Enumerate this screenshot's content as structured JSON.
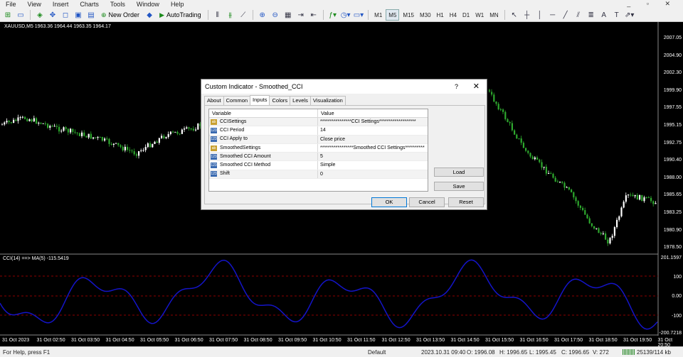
{
  "menu": [
    "File",
    "View",
    "Insert",
    "Charts",
    "Tools",
    "Window",
    "Help"
  ],
  "toolbar": {
    "new_order": "New Order",
    "autotrading": "AutoTrading",
    "timeframes": [
      "M1",
      "M5",
      "M15",
      "M30",
      "H1",
      "H4",
      "D1",
      "W1",
      "MN"
    ],
    "active_timeframe": "M5"
  },
  "chart": {
    "title": "XAUUSD,M5  1963.36 1964.44 1963.35 1964.17",
    "price_labels": [
      "2007.05",
      "2004.90",
      "2002.30",
      "1999.90",
      "1997.55",
      "1995.15",
      "1992.75",
      "1990.40",
      "1988.00",
      "1985.65",
      "1983.25",
      "1980.90",
      "1978.50"
    ],
    "indicator_title": "CCI(14) ==> MA(5) -115.5419",
    "indicator_labels": [
      "201.1597",
      "100",
      "0.00",
      "-100",
      "-200.7218"
    ],
    "time_labels": [
      "31 Oct 2023",
      "31 Oct 02:50",
      "31 Oct 03:50",
      "31 Oct 04:50",
      "31 Oct 05:50",
      "31 Oct 06:50",
      "31 Oct 07:50",
      "31 Oct 08:50",
      "31 Oct 09:50",
      "31 Oct 10:50",
      "31 Oct 11:50",
      "31 Oct 12:50",
      "31 Oct 13:50",
      "31 Oct 14:50",
      "31 Oct 15:50",
      "31 Oct 16:50",
      "31 Oct 17:50",
      "31 Oct 18:50",
      "31 Oct 19:50",
      "31 Oct 20:50"
    ],
    "colors": {
      "bull": "#ffffff",
      "bear": "#2ea82e",
      "cci_line": "#1414c8",
      "level_line": "#8b0000"
    }
  },
  "dialog": {
    "title": "Custom Indicator - Smoothed_CCI",
    "help": "?",
    "close": "✕",
    "tabs": [
      "About",
      "Common",
      "Inputs",
      "Colors",
      "Levels",
      "Visualization"
    ],
    "active_tab": "Inputs",
    "columns": [
      "Variable",
      "Value"
    ],
    "params": [
      {
        "icon": "ab",
        "name": "CCISettings",
        "value": "****************CCI Settings*******************"
      },
      {
        "icon": "123",
        "name": "CCI Period",
        "value": "14"
      },
      {
        "icon": "123",
        "name": "CCI Apply to",
        "value": "Close price"
      },
      {
        "icon": "ab",
        "name": "SmoothedSettings",
        "value": "*****************Smoothed CCI Settings**************..."
      },
      {
        "icon": "123",
        "name": "Smoothed CCI Amount",
        "value": "5"
      },
      {
        "icon": "123",
        "name": "Smoothed CCI Method",
        "value": "Simple"
      },
      {
        "icon": "123",
        "name": "Shift",
        "value": "0"
      }
    ],
    "load": "Load",
    "save": "Save",
    "ok": "OK",
    "cancel": "Cancel",
    "reset": "Reset"
  },
  "status": {
    "help": "For Help, press F1",
    "profile": "Default",
    "datetime": "2023.10.31 09:40",
    "open": "O: 1996.08",
    "high": "H: 1996.65",
    "low": "L: 1995.45",
    "close": "C: 1996.65",
    "volume": "V: 272",
    "traffic": "25139/114 kb"
  }
}
